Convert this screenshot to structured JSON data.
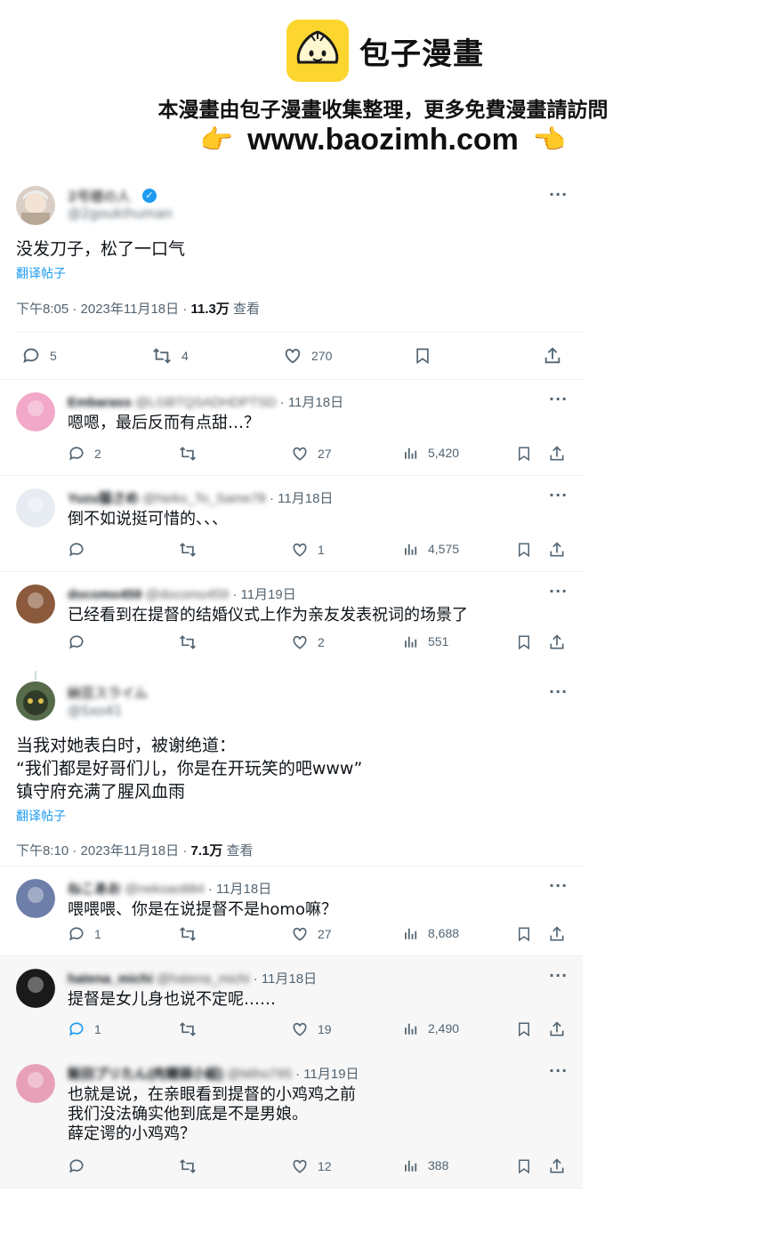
{
  "banner": {
    "logo_text": "包子漫畫",
    "subtitle": "本漫畫由包子漫畫收集整理，更多免費漫畫請訪問",
    "url": "www.baozimh.com",
    "hand_left": "👉",
    "hand_right": "👈"
  },
  "tweet1": {
    "name": "2号楼の人",
    "handle": "@2goukihuman",
    "text": "没发刀子，松了一口气",
    "translate": "翻译帖子",
    "time": "下午8:05 · 2023年11月18日 · ",
    "views": "11.3万",
    "views_suffix": " 查看",
    "replies": "5",
    "retweets": "4",
    "likes": "270"
  },
  "replies1": [
    {
      "name": "Embarass",
      "handle": "@LGBTQSADHDPTSD",
      "date": " · 11月18日",
      "text": "嗯嗯，最后反而有点甜…？",
      "replies": "2",
      "retweets": "",
      "likes": "27",
      "views": "5,420",
      "avatar_color": "#f2a8c8"
    },
    {
      "name": "Yuzu猫さめ",
      "handle": "@Neko_To_Same78",
      "date": " · 11月18日",
      "text": "倒不如说挺可惜的、、、",
      "replies": "",
      "retweets": "",
      "likes": "1",
      "views": "4,575",
      "avatar_color": "#e6ecf2"
    },
    {
      "name": "docomo459",
      "handle": "@docomo459",
      "date": " · 11月19日",
      "text": "已经看到在提督的结婚仪式上作为亲友发表祝词的场景了",
      "replies": "",
      "retweets": "",
      "likes": "2",
      "views": "551",
      "avatar_color": "#8b5a3c"
    }
  ],
  "tweet2": {
    "name": "納豆スライム",
    "handle": "@Sxo41",
    "text": "当我对她表白时，被谢绝道：\n“我们都是好哥们儿，你是在开玩笑的吧www”\n镇守府充满了腥风血雨",
    "translate": "翻译帖子",
    "time": "下午8:10 · 2023年11月18日 · ",
    "views": "7.1万",
    "views_suffix": " 查看"
  },
  "replies2": [
    {
      "name": "ねこあお",
      "handle": "@nekoao884",
      "date": " · 11月18日",
      "text": "喂喂喂、你是在说提督不是homo嘛？",
      "replies": "1",
      "retweets": "",
      "likes": "27",
      "views": "8,688",
      "avatar_color": "#6d7fa8"
    },
    {
      "name": "hatena_michi",
      "handle": "@hatena_michi",
      "date": " · 11月18日",
      "text": "提督是女儿身也说不定呢……",
      "replies": "1",
      "retweets": "",
      "likes": "19",
      "views": "2,490",
      "avatar_color": "#1a1a1a"
    },
    {
      "name": "飯田プリたん(肉饅頭小組)",
      "handle": "@Miho795",
      "date": " · 11月19日",
      "text": "也就是说，在亲眼看到提督的小鸡鸡之前\n我们没法确实他到底是不是男娘。\n薛定谔的小鸡鸡？",
      "replies": "",
      "retweets": "",
      "likes": "12",
      "views": "388",
      "avatar_color": "#e8a0b8"
    }
  ],
  "colors": {
    "accent": "#1d9bf0",
    "muted": "#536471",
    "logo_yellow": "#fcd62e"
  },
  "icons": [
    "reply-icon",
    "retweet-icon",
    "like-icon",
    "views-icon",
    "bookmark-icon",
    "share-icon",
    "more-icon",
    "verified-icon"
  ]
}
